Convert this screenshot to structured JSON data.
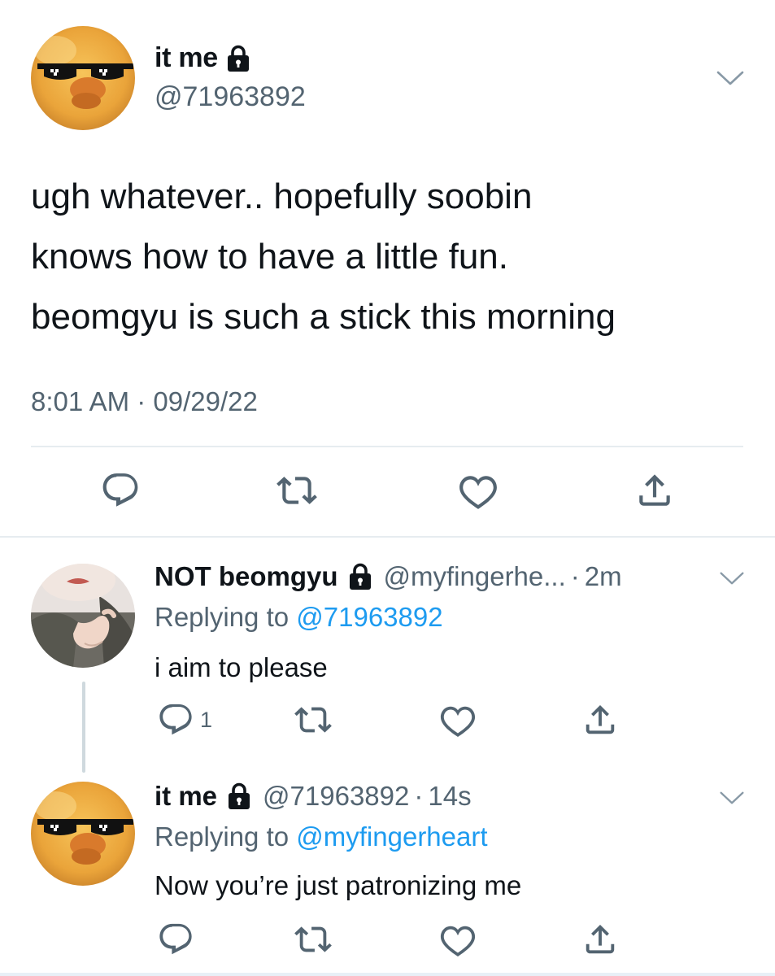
{
  "main_tweet": {
    "name": "it me",
    "handle": "@71963892",
    "text_lines": [
      "ugh whatever.. hopefully soobin",
      "knows how to have a little fun.",
      "beomgyu is such a stick this morning"
    ],
    "time": "8:01 AM",
    "sep": "·",
    "date": "09/29/22"
  },
  "replies": [
    {
      "name": "NOT beomgyu",
      "handle": "@myfingerhe...",
      "sep": "·",
      "time": "2m",
      "replying_prefix": "Replying to ",
      "replying_to": "@71963892",
      "text": "i aim to please",
      "reply_count": "1"
    },
    {
      "name": "it me",
      "handle": "@71963892",
      "sep": "·",
      "time": "14s",
      "replying_prefix": "Replying to ",
      "replying_to": "@myfingerheart",
      "text": "Now you’re just patronizing me"
    }
  ],
  "colors": {
    "text": "#0f1419",
    "secondary": "#536471",
    "link": "#1d9bf0",
    "divider": "#e6ecf0",
    "icon": "#536471"
  },
  "icons": [
    "lock-icon",
    "chevron-down-icon",
    "reply-icon",
    "retweet-icon",
    "like-icon",
    "share-icon"
  ]
}
